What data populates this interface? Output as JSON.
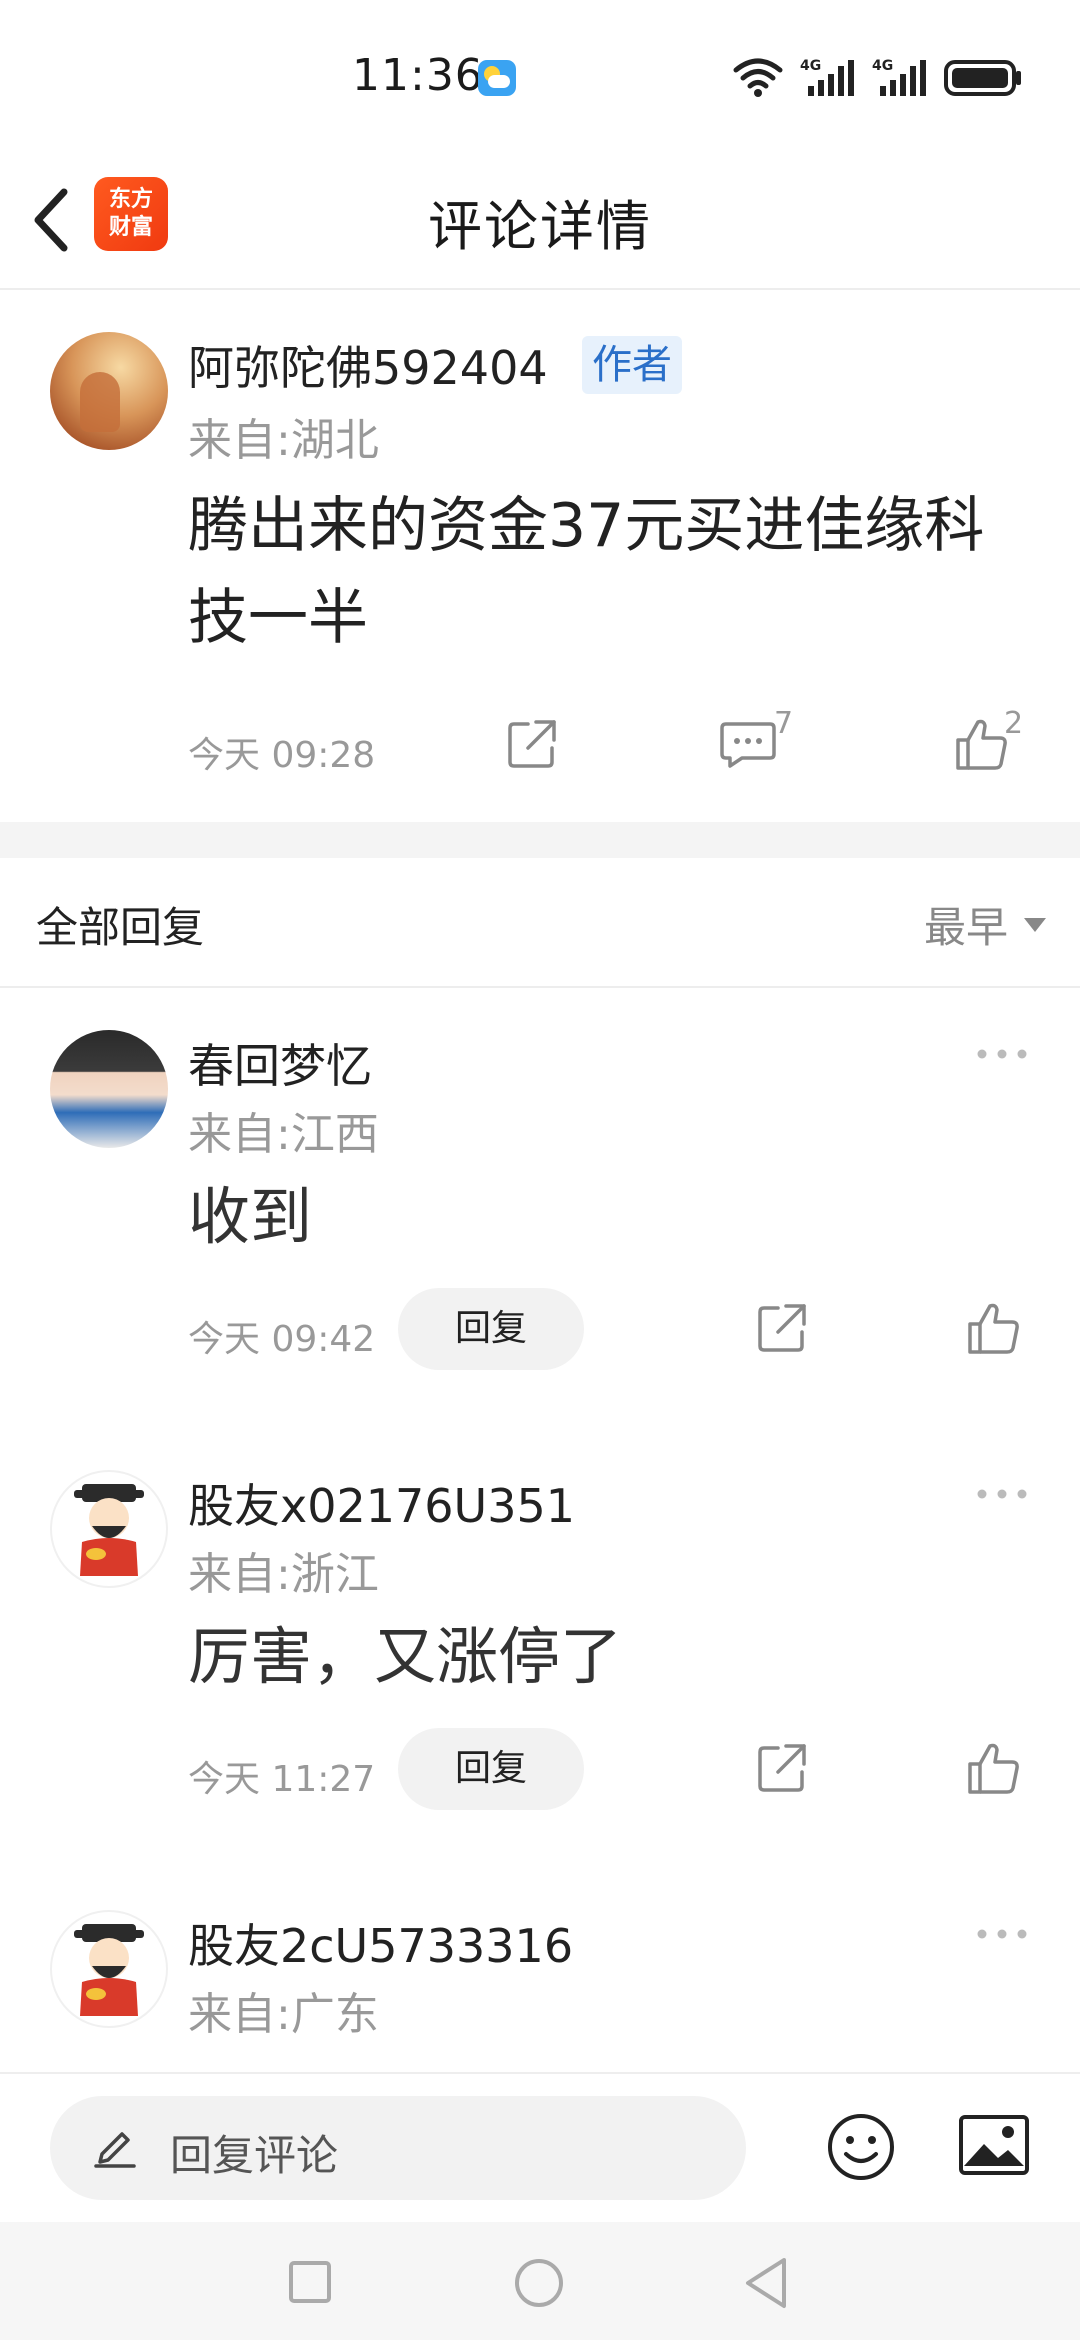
{
  "status_bar": {
    "time": "11:36",
    "weather_icon": "weather-sunny-cloud-icon",
    "network_1": "4G",
    "network_2": "4G"
  },
  "header": {
    "title": "评论详情",
    "logo_line1": "东方",
    "logo_line2": "财富"
  },
  "main_comment": {
    "author": "阿弥陀佛592404",
    "badge": "作者",
    "location": "来自:湖北",
    "text": "腾出来的资金37元买进佳缘科技一半",
    "time": "今天 09:28",
    "comment_count": "7",
    "like_count": "2"
  },
  "replies_section": {
    "title": "全部回复",
    "sort_label": "最早"
  },
  "replies": [
    {
      "name": "春回梦忆",
      "location": "来自:江西",
      "text": "收到",
      "time": "今天 09:42",
      "reply_label": "回复"
    },
    {
      "name": "股友x02176U351",
      "location": "来自:浙江",
      "text": "厉害，又涨停了",
      "time": "今天 11:27",
      "reply_label": "回复"
    },
    {
      "name": "股友2cU5733316",
      "location": "来自:广东"
    }
  ],
  "bottom_bar": {
    "placeholder": "回复评论"
  },
  "colors": {
    "brand": "#f03a10",
    "badge_text": "#2a6fc9",
    "secondary_text": "#999999"
  }
}
